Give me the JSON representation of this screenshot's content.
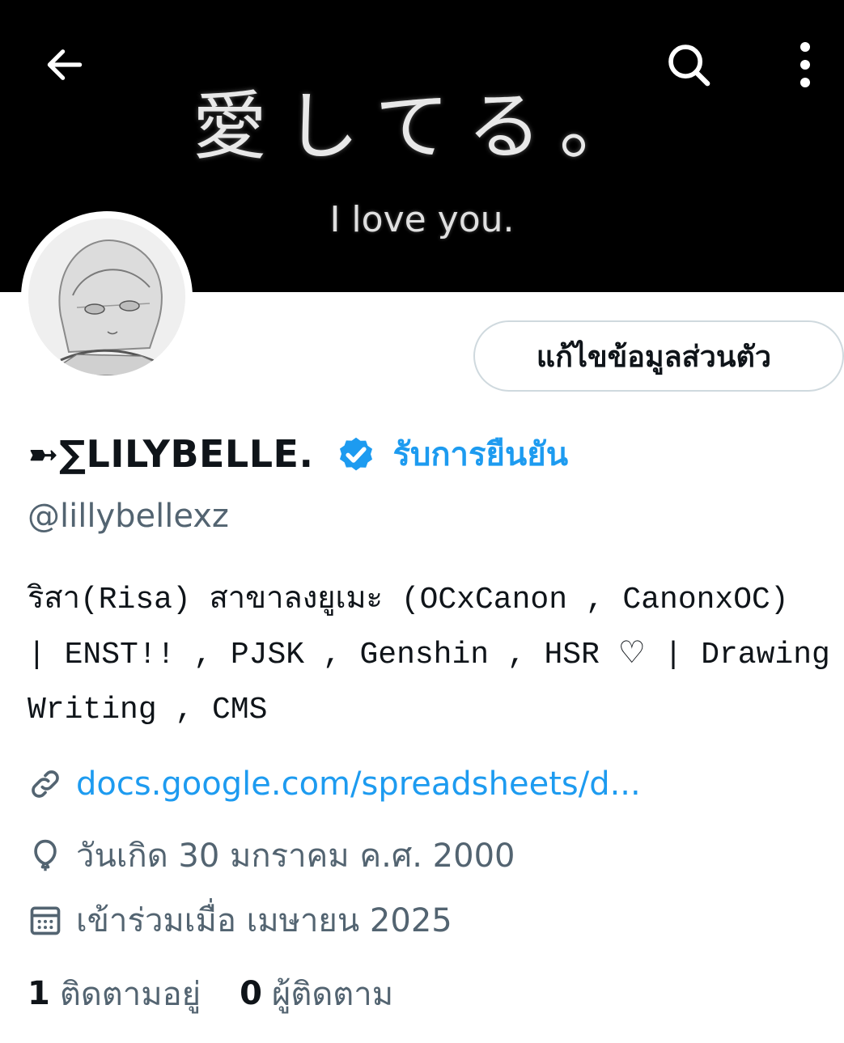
{
  "banner": {
    "text_jp": "愛してる。",
    "text_en": "I love you."
  },
  "profile": {
    "display_name": "➼∑LILYBELLE.",
    "verify_label": "รับการยืนยัน",
    "handle": "@lillybellexz",
    "edit_label": "แก้ไขข้อมูลส่วนตัว",
    "bio_lines": [
      "ริสา(Risa) สาขาลงยูเมะ (OCxCanon , CanonxOC)",
      "| ENST!! , PJSK , Genshin , HSR ♡ | Drawing ,",
      "Writing , CMS"
    ],
    "link": "docs.google.com/spreadsheets/d...",
    "birthday": "วันเกิด 30 มกราคม ค.ศ. 2000",
    "joined": "เข้าร่วมเมื่อ เมษายน 2025"
  },
  "stats": {
    "following_count": "1",
    "following_label": "ติดตามอยู่",
    "followers_count": "0",
    "followers_label": "ผู้ติดตาม"
  },
  "colors": {
    "accent": "#1d9bf0",
    "secondary_text": "#536471",
    "primary_text": "#0f1419",
    "border": "#cfd9de"
  },
  "icons": [
    "back-arrow-icon",
    "search-icon",
    "more-vertical-icon",
    "verified-badge-icon",
    "link-icon",
    "balloon-icon",
    "calendar-icon"
  ]
}
